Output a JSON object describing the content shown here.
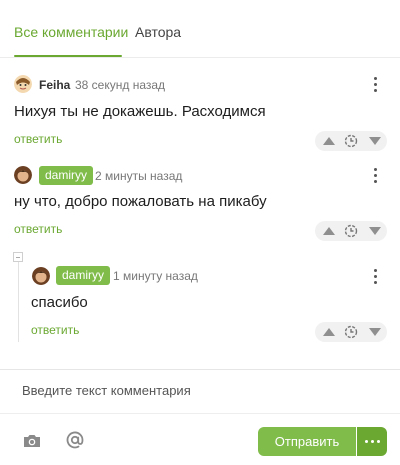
{
  "tabs": [
    {
      "label": "Все комментарии"
    },
    {
      "label": "Автора"
    }
  ],
  "comments": [
    {
      "author": "Feiha",
      "time": "38 секунд назад",
      "text": "Нихуя ты не докажешь. Расходимся",
      "reply": "ответить"
    },
    {
      "author": "damiryy",
      "time": "2 минуты назад",
      "text": "ну что, добро пожаловать на пикабу",
      "reply": "ответить"
    },
    {
      "author": "damiryy",
      "time": "1 минуту назад",
      "text": "спасибо",
      "reply": "ответить"
    }
  ],
  "composer": {
    "placeholder": "Введите текст комментария",
    "send_label": "Отправить"
  },
  "icons": {
    "more": "more-vertical-icon",
    "vote_up": "arrow-up-icon",
    "vote_down": "arrow-down-icon",
    "vote_later": "clock-icon",
    "camera": "camera-icon",
    "mention": "at-sign-icon"
  },
  "colors": {
    "accent": "#6aa831",
    "badge": "#7fbc4a"
  }
}
